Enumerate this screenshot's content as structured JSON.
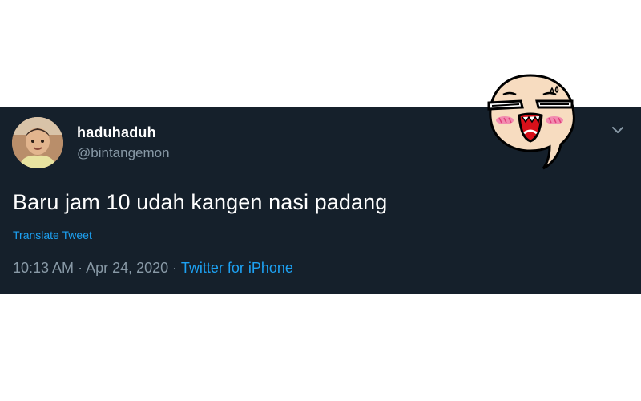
{
  "tweet": {
    "display_name": "haduhaduh",
    "handle": "@bintangemon",
    "text": "Baru jam 10 udah kangen nasi padang",
    "translate_label": "Translate Tweet",
    "time": "10:13 AM",
    "separator_1": " · ",
    "date": "Apr 24, 2020",
    "separator_2": " · ",
    "source": "Twitter for iPhone"
  },
  "icons": {
    "menu": "chevron-down-icon",
    "avatar": "profile-photo",
    "sticker": "blushing-face-sticker"
  },
  "colors": {
    "card_background": "#15202b",
    "primary_text": "#ffffff",
    "secondary_text": "#8899a6",
    "link": "#1da1f2",
    "page_background": "#ffffff"
  }
}
